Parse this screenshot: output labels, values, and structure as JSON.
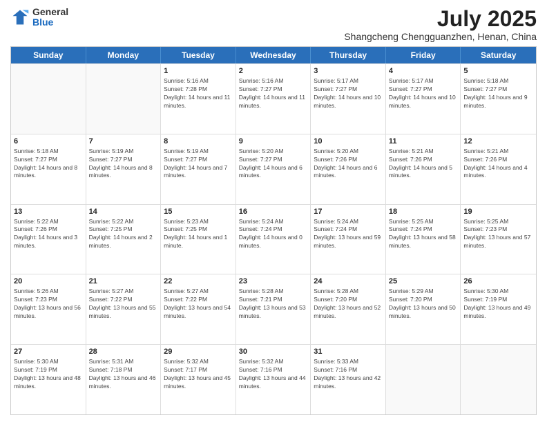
{
  "header": {
    "logo_general": "General",
    "logo_blue": "Blue",
    "month_year": "July 2025",
    "location": "Shangcheng Chengguanzhen, Henan, China"
  },
  "weekdays": [
    "Sunday",
    "Monday",
    "Tuesday",
    "Wednesday",
    "Thursday",
    "Friday",
    "Saturday"
  ],
  "rows": [
    [
      {
        "day": "",
        "info": ""
      },
      {
        "day": "",
        "info": ""
      },
      {
        "day": "1",
        "info": "Sunrise: 5:16 AM\nSunset: 7:28 PM\nDaylight: 14 hours and 11 minutes."
      },
      {
        "day": "2",
        "info": "Sunrise: 5:16 AM\nSunset: 7:27 PM\nDaylight: 14 hours and 11 minutes."
      },
      {
        "day": "3",
        "info": "Sunrise: 5:17 AM\nSunset: 7:27 PM\nDaylight: 14 hours and 10 minutes."
      },
      {
        "day": "4",
        "info": "Sunrise: 5:17 AM\nSunset: 7:27 PM\nDaylight: 14 hours and 10 minutes."
      },
      {
        "day": "5",
        "info": "Sunrise: 5:18 AM\nSunset: 7:27 PM\nDaylight: 14 hours and 9 minutes."
      }
    ],
    [
      {
        "day": "6",
        "info": "Sunrise: 5:18 AM\nSunset: 7:27 PM\nDaylight: 14 hours and 8 minutes."
      },
      {
        "day": "7",
        "info": "Sunrise: 5:19 AM\nSunset: 7:27 PM\nDaylight: 14 hours and 8 minutes."
      },
      {
        "day": "8",
        "info": "Sunrise: 5:19 AM\nSunset: 7:27 PM\nDaylight: 14 hours and 7 minutes."
      },
      {
        "day": "9",
        "info": "Sunrise: 5:20 AM\nSunset: 7:27 PM\nDaylight: 14 hours and 6 minutes."
      },
      {
        "day": "10",
        "info": "Sunrise: 5:20 AM\nSunset: 7:26 PM\nDaylight: 14 hours and 6 minutes."
      },
      {
        "day": "11",
        "info": "Sunrise: 5:21 AM\nSunset: 7:26 PM\nDaylight: 14 hours and 5 minutes."
      },
      {
        "day": "12",
        "info": "Sunrise: 5:21 AM\nSunset: 7:26 PM\nDaylight: 14 hours and 4 minutes."
      }
    ],
    [
      {
        "day": "13",
        "info": "Sunrise: 5:22 AM\nSunset: 7:26 PM\nDaylight: 14 hours and 3 minutes."
      },
      {
        "day": "14",
        "info": "Sunrise: 5:22 AM\nSunset: 7:25 PM\nDaylight: 14 hours and 2 minutes."
      },
      {
        "day": "15",
        "info": "Sunrise: 5:23 AM\nSunset: 7:25 PM\nDaylight: 14 hours and 1 minute."
      },
      {
        "day": "16",
        "info": "Sunrise: 5:24 AM\nSunset: 7:24 PM\nDaylight: 14 hours and 0 minutes."
      },
      {
        "day": "17",
        "info": "Sunrise: 5:24 AM\nSunset: 7:24 PM\nDaylight: 13 hours and 59 minutes."
      },
      {
        "day": "18",
        "info": "Sunrise: 5:25 AM\nSunset: 7:24 PM\nDaylight: 13 hours and 58 minutes."
      },
      {
        "day": "19",
        "info": "Sunrise: 5:25 AM\nSunset: 7:23 PM\nDaylight: 13 hours and 57 minutes."
      }
    ],
    [
      {
        "day": "20",
        "info": "Sunrise: 5:26 AM\nSunset: 7:23 PM\nDaylight: 13 hours and 56 minutes."
      },
      {
        "day": "21",
        "info": "Sunrise: 5:27 AM\nSunset: 7:22 PM\nDaylight: 13 hours and 55 minutes."
      },
      {
        "day": "22",
        "info": "Sunrise: 5:27 AM\nSunset: 7:22 PM\nDaylight: 13 hours and 54 minutes."
      },
      {
        "day": "23",
        "info": "Sunrise: 5:28 AM\nSunset: 7:21 PM\nDaylight: 13 hours and 53 minutes."
      },
      {
        "day": "24",
        "info": "Sunrise: 5:28 AM\nSunset: 7:20 PM\nDaylight: 13 hours and 52 minutes."
      },
      {
        "day": "25",
        "info": "Sunrise: 5:29 AM\nSunset: 7:20 PM\nDaylight: 13 hours and 50 minutes."
      },
      {
        "day": "26",
        "info": "Sunrise: 5:30 AM\nSunset: 7:19 PM\nDaylight: 13 hours and 49 minutes."
      }
    ],
    [
      {
        "day": "27",
        "info": "Sunrise: 5:30 AM\nSunset: 7:19 PM\nDaylight: 13 hours and 48 minutes."
      },
      {
        "day": "28",
        "info": "Sunrise: 5:31 AM\nSunset: 7:18 PM\nDaylight: 13 hours and 46 minutes."
      },
      {
        "day": "29",
        "info": "Sunrise: 5:32 AM\nSunset: 7:17 PM\nDaylight: 13 hours and 45 minutes."
      },
      {
        "day": "30",
        "info": "Sunrise: 5:32 AM\nSunset: 7:16 PM\nDaylight: 13 hours and 44 minutes."
      },
      {
        "day": "31",
        "info": "Sunrise: 5:33 AM\nSunset: 7:16 PM\nDaylight: 13 hours and 42 minutes."
      },
      {
        "day": "",
        "info": ""
      },
      {
        "day": "",
        "info": ""
      }
    ]
  ]
}
